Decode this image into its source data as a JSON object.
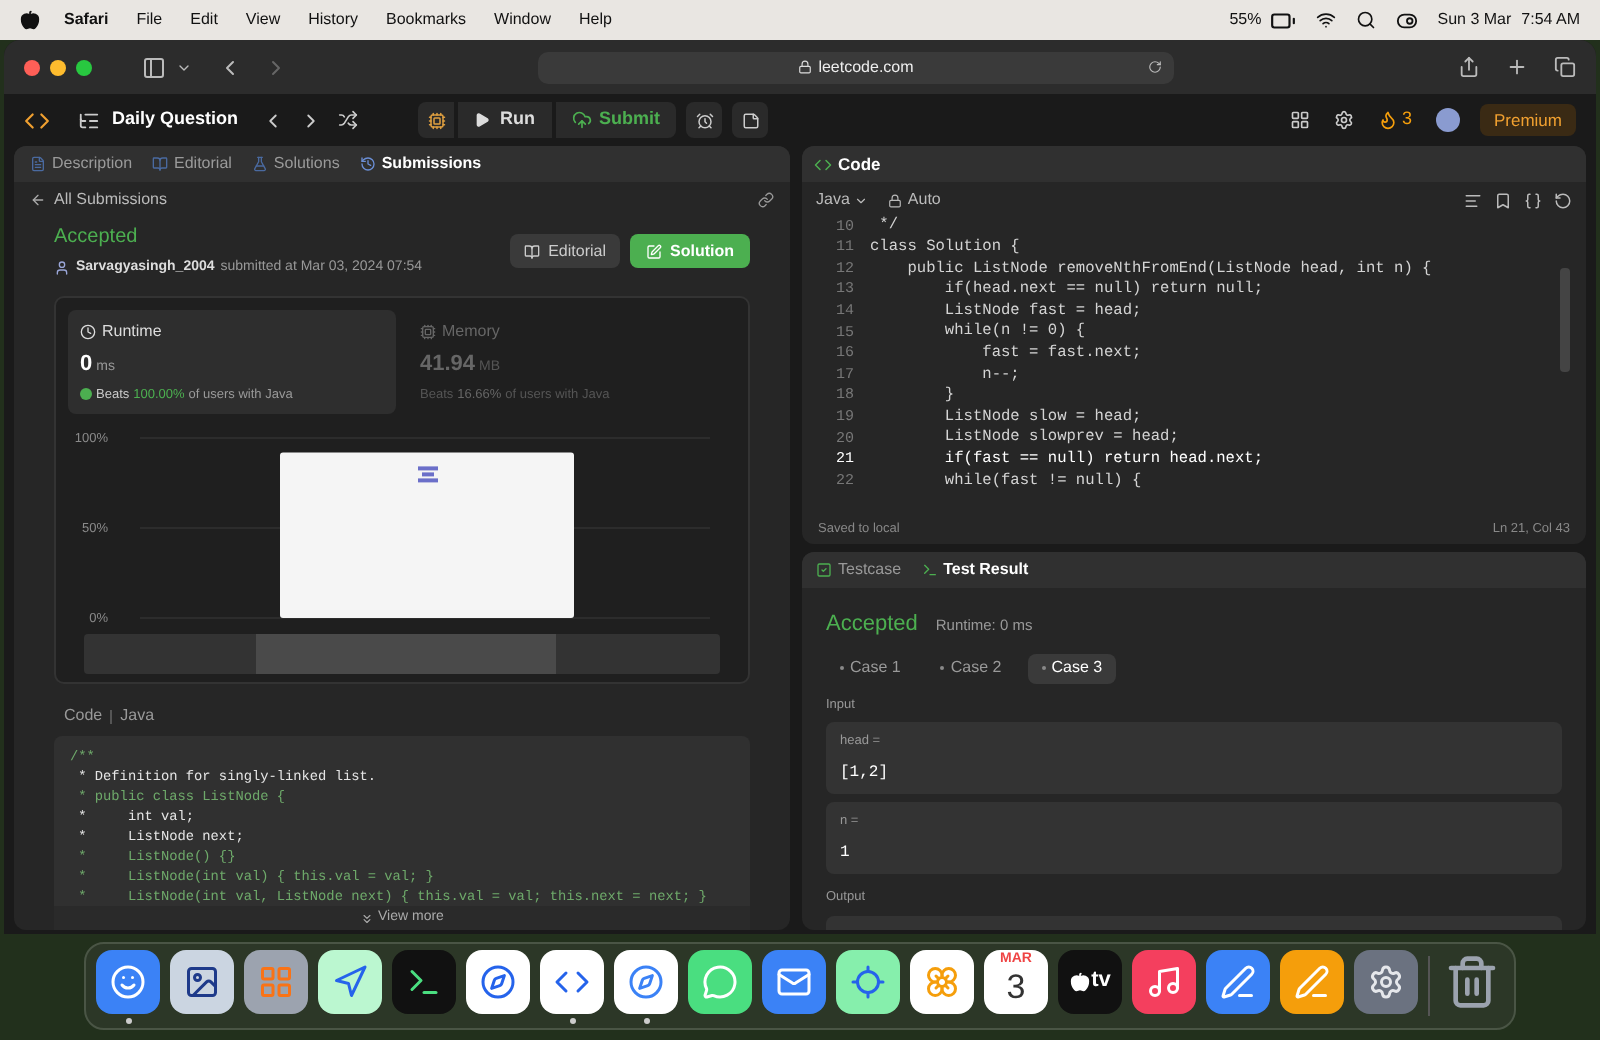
{
  "menu_bar": {
    "app": "Safari",
    "items": [
      "File",
      "Edit",
      "View",
      "History",
      "Bookmarks",
      "Window",
      "Help"
    ],
    "battery": "55%",
    "date": "Sun 3 Mar",
    "time": "7:54 AM"
  },
  "browser": {
    "url": "leetcode.com"
  },
  "nav": {
    "title": "Daily Question",
    "run": "Run",
    "submit": "Submit",
    "streak": "3",
    "premium": "Premium"
  },
  "left_panel": {
    "tabs": [
      {
        "label": "Description",
        "selected": false
      },
      {
        "label": "Editorial",
        "selected": false
      },
      {
        "label": "Solutions",
        "selected": false
      },
      {
        "label": "Submissions",
        "selected": true
      }
    ],
    "back_link": "All Submissions",
    "status": "Accepted",
    "user": "Sarvagyasingh_2004",
    "submitted": "submitted at Mar 03, 2024 07:54",
    "editorial_button": "Editorial",
    "solution_button": "Solution",
    "metrics": [
      {
        "kind": "runtime",
        "title": "Runtime",
        "value": "0",
        "unit": "ms",
        "beats_label": "Beats",
        "beats": "100.00%",
        "suffix": "of users with Java",
        "selected": true
      },
      {
        "kind": "memory",
        "title": "Memory",
        "value": "41.94",
        "unit": "MB",
        "beats_label": "Beats",
        "beats": "16.66%",
        "suffix": "of users with Java",
        "selected": false
      }
    ],
    "chart_data": {
      "type": "bar",
      "values": [
        92
      ],
      "ylim": [
        0,
        100
      ],
      "yticks": [
        {
          "value": 0,
          "label": "0%"
        },
        {
          "value": 50,
          "label": "50%"
        },
        {
          "value": 100,
          "label": "100%"
        }
      ]
    },
    "code_label": "Code",
    "code_language": "Java",
    "code_lines": [
      {
        "text": "/**",
        "kind": "accent"
      },
      {
        "text": " * Definition for singly-linked list.",
        "kind": "plain"
      },
      {
        "text": " * public class ListNode {",
        "kind": "accent"
      },
      {
        "text": " *     int val;",
        "kind": "plain"
      },
      {
        "text": " *     ListNode next;",
        "kind": "plain"
      },
      {
        "text": " *     ListNode() {}",
        "kind": "accent"
      },
      {
        "text": " *     ListNode(int val) { this.val = val; }",
        "kind": "accent"
      },
      {
        "text": " *     ListNode(int val, ListNode next) { this.val = val; this.next = next; }",
        "kind": "accent"
      }
    ],
    "view_more": "View more"
  },
  "editor": {
    "title": "Code",
    "language": "Java",
    "mode": "Auto",
    "lines": [
      {
        "number": "10",
        "text": " */",
        "active": false
      },
      {
        "number": "11",
        "text": "class Solution {",
        "active": false
      },
      {
        "number": "12",
        "text": "    public ListNode removeNthFromEnd(ListNode head, int n) {",
        "active": false
      },
      {
        "number": "13",
        "text": "        if(head.next == null) return null;",
        "active": false
      },
      {
        "number": "14",
        "text": "        ListNode fast = head;",
        "active": false
      },
      {
        "number": "15",
        "text": "        while(n != 0) {",
        "active": false
      },
      {
        "number": "16",
        "text": "            fast = fast.next;",
        "active": false
      },
      {
        "number": "17",
        "text": "            n--;",
        "active": false
      },
      {
        "number": "18",
        "text": "        }",
        "active": false
      },
      {
        "number": "19",
        "text": "        ListNode slow = head;",
        "active": false
      },
      {
        "number": "20",
        "text": "        ListNode slowprev = head;",
        "active": false
      },
      {
        "number": "21",
        "text": "        if(fast == null) return head.next;",
        "active": true
      },
      {
        "number": "22",
        "text": "        while(fast != null) {",
        "active": false
      }
    ],
    "saved": "Saved to local",
    "cursor": "Ln 21, Col 43"
  },
  "result": {
    "tabs": [
      {
        "label": "Testcase",
        "selected": false
      },
      {
        "label": "Test Result",
        "selected": true
      }
    ],
    "status": "Accepted",
    "runtime": "Runtime: 0 ms",
    "cases": [
      {
        "label": "Case 1",
        "selected": false
      },
      {
        "label": "Case 2",
        "selected": false
      },
      {
        "label": "Case 3",
        "selected": true
      }
    ],
    "input_label": "Input",
    "inputs": [
      {
        "name": "head =",
        "value": "[1,2]"
      },
      {
        "name": "n =",
        "value": "1"
      }
    ],
    "output_label": "Output"
  },
  "dock": [
    {
      "kind": "finder",
      "running": true
    },
    {
      "kind": "preview",
      "running": false
    },
    {
      "kind": "launchpad",
      "running": false
    },
    {
      "kind": "maps",
      "running": false
    },
    {
      "kind": "terminal",
      "running": false
    },
    {
      "kind": "instruments",
      "running": false
    },
    {
      "kind": "vscode",
      "running": true
    },
    {
      "kind": "safari",
      "running": true
    },
    {
      "kind": "messages",
      "running": false
    },
    {
      "kind": "mail",
      "running": false
    },
    {
      "kind": "findmy",
      "running": false
    },
    {
      "kind": "photos",
      "running": false
    },
    {
      "kind": "calendar",
      "running": false,
      "month": "MAR",
      "day": "3"
    },
    {
      "kind": "tv",
      "running": false,
      "label": "tv"
    },
    {
      "kind": "music",
      "running": false
    },
    {
      "kind": "appstore",
      "running": false
    },
    {
      "kind": "pages",
      "running": false
    },
    {
      "kind": "settings",
      "running": false
    },
    {
      "kind": "trash",
      "running": false
    }
  ]
}
